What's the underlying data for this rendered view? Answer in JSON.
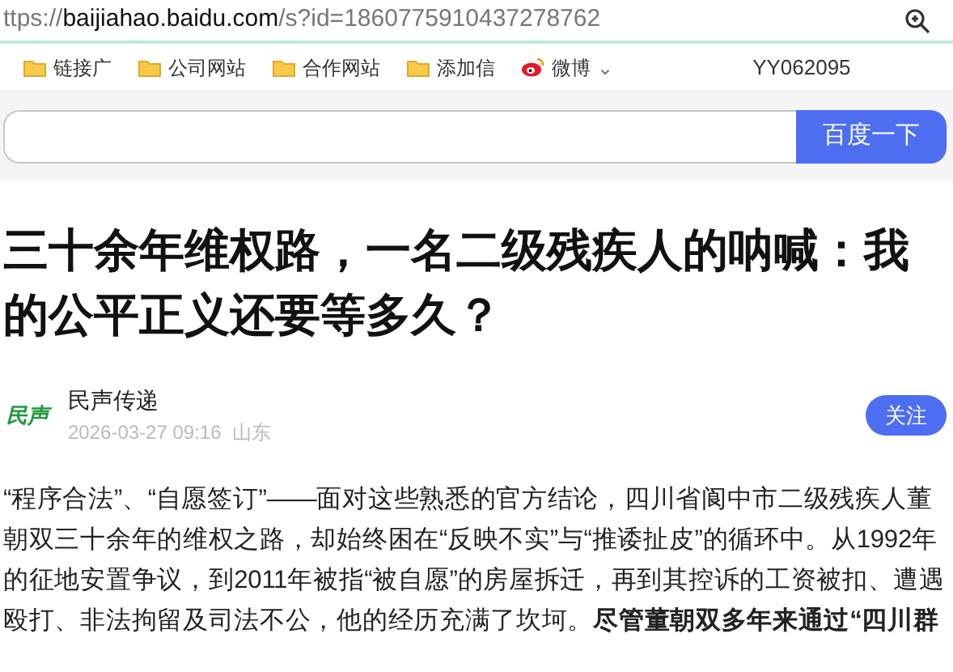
{
  "address_bar": {
    "url_prefix": "ttps://",
    "url_host": "baijiahao.baidu.com",
    "url_path": "/s?id=1860775910437278762"
  },
  "bookmarks": [
    {
      "kind": "folder",
      "label": "链接广"
    },
    {
      "kind": "folder",
      "label": "公司网站"
    },
    {
      "kind": "folder",
      "label": "合作网站"
    },
    {
      "kind": "folder",
      "label": "添加信"
    },
    {
      "kind": "weibo",
      "label": "微博",
      "caret": "⌄"
    },
    {
      "kind": "text",
      "label": "YY062095"
    }
  ],
  "search": {
    "button": "百度一下"
  },
  "article": {
    "title": "三十余年维权路，一名二级残疾人的呐喊：我的公平正义还要等多久？",
    "author": {
      "name": "民声传递",
      "logo": "民声",
      "meta": "2026-03-27 09:16  山东",
      "follow": "关注"
    },
    "paragraph": "“程序合法”、“自愿签订”——面对这些熟悉的官方结论，四川省阆中市二级残疾人董朝双三十余年的维权之路，却始终困在“反映不实”与“推诿扯皮”的循环中。从1992年的征地安置争议，到2011年被指“被自愿”的房屋拆迁，再到其控诉的工资被扣、遭遇殴打、非法拘留及司法不公，他的经历充满了坎坷。**尽管董朝双多年来通过“四川群**"
  }
}
